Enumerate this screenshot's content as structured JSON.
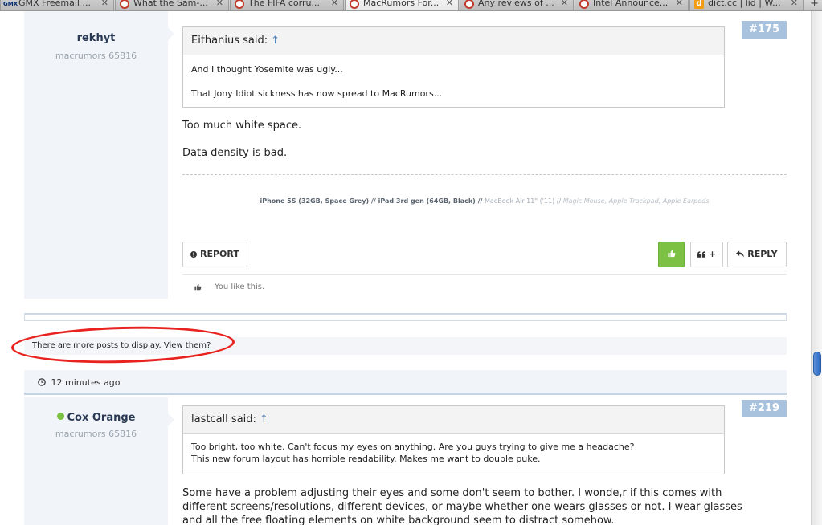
{
  "browser": {
    "tabs": [
      {
        "title": "GMX Freemail ...",
        "icon": "gmx-icon"
      },
      {
        "title": "What the Sam-...",
        "icon": "macrumors-icon"
      },
      {
        "title": "The FIFA corru...",
        "icon": "macrumors-icon"
      },
      {
        "title": "MacRumors For...",
        "icon": "macrumors-icon",
        "active": true
      },
      {
        "title": "Any reviews of ...",
        "icon": "macrumors-icon"
      },
      {
        "title": "Intel Announce...",
        "icon": "macrumors-icon"
      },
      {
        "title": "dict.cc | lid | W...",
        "icon": "dictcc-icon"
      }
    ],
    "close_glyph": "✕",
    "new_tab_glyph": "+",
    "gmx_label": "GMX",
    "dict_label": "d"
  },
  "post1": {
    "username": "rekhyt",
    "usertitle": "macrumors 65816",
    "number": "#175",
    "quote": {
      "author": "Eithanius said:",
      "arrow": "↑",
      "lines": [
        "And I thought Yosemite was ugly...",
        "That Jony Idiot sickness has now spread to MacRumors..."
      ]
    },
    "body": [
      "Too much white space.",
      "Data density is bad."
    ],
    "signature": {
      "strong": "iPhone 5S (32GB, Space Grey) // iPad 3rd gen (64GB, Black) //",
      "mid": "MacBook Air 11\" ('11) //",
      "light": "Magic Mouse, Apple Trackpad, Apple Earpods"
    },
    "actions": {
      "report": "REPORT",
      "like": "",
      "quote": "+",
      "reply": "REPLY"
    },
    "likes_text": "You like this."
  },
  "thread": {
    "more_posts": "There are more posts to display. View them?",
    "time": "12 minutes ago"
  },
  "post2": {
    "username": "Cox Orange",
    "usertitle": "macrumors 65816",
    "number": "#219",
    "online": true,
    "quote": {
      "author": "lastcall said:",
      "arrow": "↑",
      "lines": [
        "Too bright, too white. Can't focus my eyes on anything. Are you guys trying to give me a headache?",
        "This new forum layout has horrible readability. Makes me want to double puke."
      ]
    },
    "body": [
      "Some have a problem adjusting their eyes and some don't seem to bother. I wonde,r if this comes with",
      "different screens/resolutions, different devices, or maybe whether one wears glasses or not. I wear glasses",
      "and all the free floating elements on white background seem to distract somehow."
    ]
  },
  "colors": {
    "accent_blue": "#a8c2de",
    "like_green": "#7cc144",
    "annotation_red": "#e8231f"
  }
}
